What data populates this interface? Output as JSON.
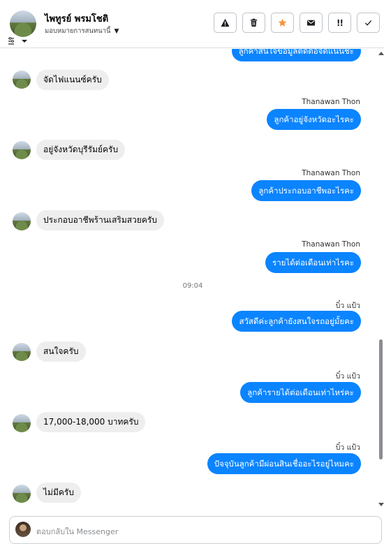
{
  "header": {
    "contact_name": "ไพทูรย์ พรมโชติ",
    "assign_label": "มอบหมายการสนทนานี้",
    "actions": [
      {
        "name": "mark-spam",
        "icon": "warning-icon"
      },
      {
        "name": "delete",
        "icon": "trash-icon"
      },
      {
        "name": "follow-up",
        "icon": "star-icon",
        "color": "#f7923b"
      },
      {
        "name": "mark-unread",
        "icon": "envelope-icon"
      },
      {
        "name": "priority",
        "icon": "priority-icon",
        "label": "!!"
      },
      {
        "name": "mark-done",
        "icon": "check-icon"
      }
    ]
  },
  "colors": {
    "outgoing_bubble": "#0b84ff",
    "incoming_bubble": "#eeeeef"
  },
  "conversation": {
    "top_partial_text": "ลูกค้าสนใจข้อมูลติดต่อจัดแนนชะ",
    "messages": [
      {
        "type": "in",
        "text": "จัดไฟแนนซ์ครับ"
      },
      {
        "type": "out",
        "sender": "Thanawan Thon",
        "text": "ลูกค้าอยู่จังหวัดอะไรคะ"
      },
      {
        "type": "in",
        "text": "อยู่จังหวัดบุรีรัมย์ครับ"
      },
      {
        "type": "out",
        "sender": "Thanawan Thon",
        "text": "ลูกค้าประกอบอาชีพอะไรคะ"
      },
      {
        "type": "in",
        "text": "ประกอบอาชีพร้านเสริมสวยครับ"
      },
      {
        "type": "out",
        "sender": "Thanawan Thon",
        "text": "รายได้ต่อเดือนเท่าไรคะ"
      },
      {
        "type": "time",
        "text": "09:04"
      },
      {
        "type": "out",
        "sender": "บิ๋ว แป้ว",
        "text": "สวัสดีค่ะลูกค้ายังสนใจรถอยู่มั้ยคะ"
      },
      {
        "type": "in",
        "text": "สนใจครับ"
      },
      {
        "type": "out",
        "sender": "บิ๋ว แป้ว",
        "text": "ลูกค้ารายได้ต่อเดือนเท่าไหร่คะ"
      },
      {
        "type": "in",
        "text": "17,000-18,000 บาทครับ"
      },
      {
        "type": "out",
        "sender": "บิ๋ว แป้ว",
        "text": "ปัจจุบันลูกค้ามีผ่อนสินเชื่ออะไรอยู่ไหมคะ"
      },
      {
        "type": "in",
        "text": "ไม่มีครับ"
      }
    ]
  },
  "composer": {
    "placeholder": "ตอบกลับใน Messenger"
  }
}
